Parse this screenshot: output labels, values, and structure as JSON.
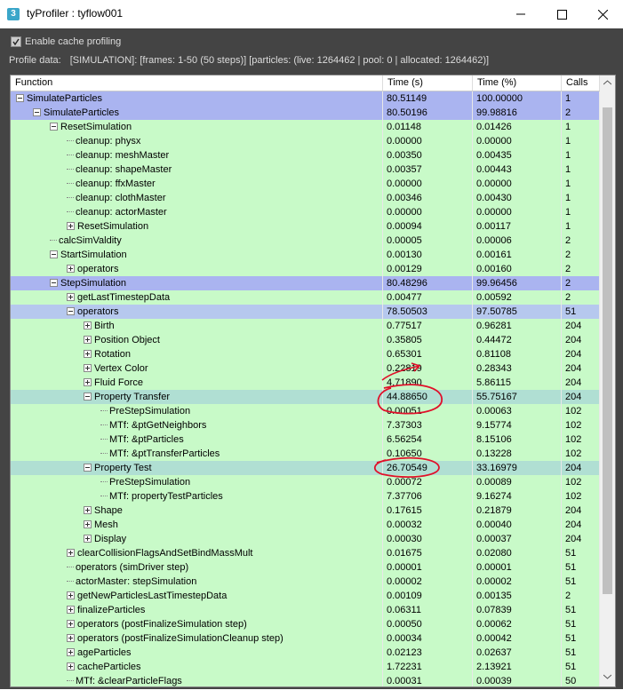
{
  "window": {
    "title": "tyProfiler : tyflow001",
    "app_icon": "3",
    "minimize_icon": "minimize-icon",
    "maximize_icon": "maximize-icon",
    "close_icon": "close-icon"
  },
  "options": {
    "cache_profiling_label": "Enable cache profiling",
    "cache_profiling_checked": true
  },
  "profile": {
    "label": "Profile data:",
    "value": "[SIMULATION]: [frames: 1-50 (50 steps)] [particles: (live: 1264462 | pool: 0 | allocated: 1264462)]"
  },
  "table": {
    "columns": [
      "Function",
      "Time (s)",
      "Time (%)",
      "Calls"
    ],
    "rows": [
      {
        "name": "SimulateParticles",
        "time": "80.51149",
        "pct": "100.00000",
        "calls": "1",
        "level": 0,
        "exp": "minus",
        "style": "sel1"
      },
      {
        "name": "SimulateParticles",
        "time": "80.50196",
        "pct": "99.98816",
        "calls": "2",
        "level": 1,
        "exp": "minus",
        "style": "sel1"
      },
      {
        "name": "ResetSimulation",
        "time": "0.01148",
        "pct": "0.01426",
        "calls": "1",
        "level": 2,
        "exp": "minus",
        "style": ""
      },
      {
        "name": "cleanup: physx",
        "time": "0.00000",
        "pct": "0.00000",
        "calls": "1",
        "level": 3,
        "exp": "none",
        "style": ""
      },
      {
        "name": "cleanup: meshMaster",
        "time": "0.00350",
        "pct": "0.00435",
        "calls": "1",
        "level": 3,
        "exp": "none",
        "style": ""
      },
      {
        "name": "cleanup: shapeMaster",
        "time": "0.00357",
        "pct": "0.00443",
        "calls": "1",
        "level": 3,
        "exp": "none",
        "style": ""
      },
      {
        "name": "cleanup: ffxMaster",
        "time": "0.00000",
        "pct": "0.00000",
        "calls": "1",
        "level": 3,
        "exp": "none",
        "style": ""
      },
      {
        "name": "cleanup: clothMaster",
        "time": "0.00346",
        "pct": "0.00430",
        "calls": "1",
        "level": 3,
        "exp": "none",
        "style": ""
      },
      {
        "name": "cleanup: actorMaster",
        "time": "0.00000",
        "pct": "0.00000",
        "calls": "1",
        "level": 3,
        "exp": "none",
        "style": ""
      },
      {
        "name": "ResetSimulation",
        "time": "0.00094",
        "pct": "0.00117",
        "calls": "1",
        "level": 3,
        "exp": "plus",
        "style": ""
      },
      {
        "name": "calcSimValdity",
        "time": "0.00005",
        "pct": "0.00006",
        "calls": "2",
        "level": 2,
        "exp": "none",
        "style": ""
      },
      {
        "name": "StartSimulation",
        "time": "0.00130",
        "pct": "0.00161",
        "calls": "2",
        "level": 2,
        "exp": "minus",
        "style": ""
      },
      {
        "name": "operators",
        "time": "0.00129",
        "pct": "0.00160",
        "calls": "2",
        "level": 3,
        "exp": "plus",
        "style": ""
      },
      {
        "name": "StepSimulation",
        "time": "80.48296",
        "pct": "99.96456",
        "calls": "2",
        "level": 2,
        "exp": "minus",
        "style": "sel1"
      },
      {
        "name": "getLastTimestepData",
        "time": "0.00477",
        "pct": "0.00592",
        "calls": "2",
        "level": 3,
        "exp": "plus",
        "style": ""
      },
      {
        "name": "operators",
        "time": "78.50503",
        "pct": "97.50785",
        "calls": "51",
        "level": 3,
        "exp": "minus",
        "style": "sel2"
      },
      {
        "name": "Birth",
        "time": "0.77517",
        "pct": "0.96281",
        "calls": "204",
        "level": 4,
        "exp": "plus",
        "style": ""
      },
      {
        "name": "Position Object",
        "time": "0.35805",
        "pct": "0.44472",
        "calls": "204",
        "level": 4,
        "exp": "plus",
        "style": ""
      },
      {
        "name": "Rotation",
        "time": "0.65301",
        "pct": "0.81108",
        "calls": "204",
        "level": 4,
        "exp": "plus",
        "style": ""
      },
      {
        "name": "Vertex Color",
        "time": "0.22819",
        "pct": "0.28343",
        "calls": "204",
        "level": 4,
        "exp": "plus",
        "style": ""
      },
      {
        "name": "Fluid Force",
        "time": "4.71890",
        "pct": "5.86115",
        "calls": "204",
        "level": 4,
        "exp": "plus",
        "style": ""
      },
      {
        "name": "Property Transfer",
        "time": "44.88650",
        "pct": "55.75167",
        "calls": "204",
        "level": 4,
        "exp": "minus",
        "style": "hl"
      },
      {
        "name": "PreStepSimulation",
        "time": "0.00051",
        "pct": "0.00063",
        "calls": "102",
        "level": 5,
        "exp": "none",
        "style": ""
      },
      {
        "name": "MTf: &ptGetNeighbors",
        "time": "7.37303",
        "pct": "9.15774",
        "calls": "102",
        "level": 5,
        "exp": "none",
        "style": ""
      },
      {
        "name": "MTf: &ptParticles",
        "time": "6.56254",
        "pct": "8.15106",
        "calls": "102",
        "level": 5,
        "exp": "none",
        "style": ""
      },
      {
        "name": "MTf: &ptTransferParticles",
        "time": "0.10650",
        "pct": "0.13228",
        "calls": "102",
        "level": 5,
        "exp": "none",
        "style": ""
      },
      {
        "name": "Property Test",
        "time": "26.70549",
        "pct": "33.16979",
        "calls": "204",
        "level": 4,
        "exp": "minus",
        "style": "hl"
      },
      {
        "name": "PreStepSimulation",
        "time": "0.00072",
        "pct": "0.00089",
        "calls": "102",
        "level": 5,
        "exp": "none",
        "style": ""
      },
      {
        "name": "MTf: propertyTestParticles",
        "time": "7.37706",
        "pct": "9.16274",
        "calls": "102",
        "level": 5,
        "exp": "none",
        "style": ""
      },
      {
        "name": "Shape",
        "time": "0.17615",
        "pct": "0.21879",
        "calls": "204",
        "level": 4,
        "exp": "plus",
        "style": ""
      },
      {
        "name": "Mesh",
        "time": "0.00032",
        "pct": "0.00040",
        "calls": "204",
        "level": 4,
        "exp": "plus",
        "style": ""
      },
      {
        "name": "Display",
        "time": "0.00030",
        "pct": "0.00037",
        "calls": "204",
        "level": 4,
        "exp": "plus",
        "style": ""
      },
      {
        "name": "clearCollisionFlagsAndSetBindMassMult",
        "time": "0.01675",
        "pct": "0.02080",
        "calls": "51",
        "level": 3,
        "exp": "plus",
        "style": ""
      },
      {
        "name": "operators (simDriver step)",
        "time": "0.00001",
        "pct": "0.00001",
        "calls": "51",
        "level": 3,
        "exp": "none",
        "style": ""
      },
      {
        "name": "actorMaster: stepSimulation",
        "time": "0.00002",
        "pct": "0.00002",
        "calls": "51",
        "level": 3,
        "exp": "none",
        "style": ""
      },
      {
        "name": "getNewParticlesLastTimestepData",
        "time": "0.00109",
        "pct": "0.00135",
        "calls": "2",
        "level": 3,
        "exp": "plus",
        "style": ""
      },
      {
        "name": "finalizeParticles",
        "time": "0.06311",
        "pct": "0.07839",
        "calls": "51",
        "level": 3,
        "exp": "plus",
        "style": ""
      },
      {
        "name": "operators (postFinalizeSimulation step)",
        "time": "0.00050",
        "pct": "0.00062",
        "calls": "51",
        "level": 3,
        "exp": "plus",
        "style": ""
      },
      {
        "name": "operators (postFinalizeSimulationCleanup step)",
        "time": "0.00034",
        "pct": "0.00042",
        "calls": "51",
        "level": 3,
        "exp": "plus",
        "style": ""
      },
      {
        "name": "ageParticles",
        "time": "0.02123",
        "pct": "0.02637",
        "calls": "51",
        "level": 3,
        "exp": "plus",
        "style": ""
      },
      {
        "name": "cacheParticles",
        "time": "1.72231",
        "pct": "2.13921",
        "calls": "51",
        "level": 3,
        "exp": "plus",
        "style": ""
      },
      {
        "name": "MTf: &clearParticleFlags",
        "time": "0.00031",
        "pct": "0.00039",
        "calls": "50",
        "level": 3,
        "exp": "none",
        "style": ""
      }
    ]
  },
  "colors": {
    "row_bg": "#c8fac8",
    "selected": "#aab4f0",
    "highlight": "#b0dfd3",
    "annotation": "#e0102a"
  }
}
